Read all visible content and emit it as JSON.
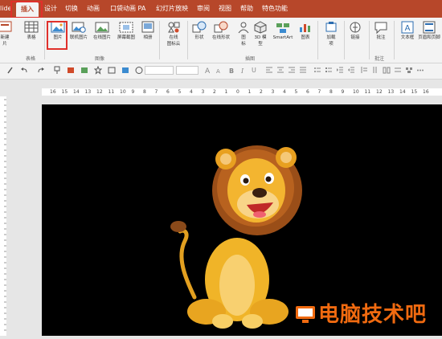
{
  "tabs": [
    {
      "label": "lide",
      "active": false
    },
    {
      "label": "插入",
      "active": true
    },
    {
      "label": "设计",
      "active": false
    },
    {
      "label": "切换",
      "active": false
    },
    {
      "label": "动画",
      "active": false
    },
    {
      "label": "口袋动画 PA",
      "active": false
    },
    {
      "label": "幻灯片放映",
      "active": false
    },
    {
      "label": "审阅",
      "active": false
    },
    {
      "label": "视图",
      "active": false
    },
    {
      "label": "帮助",
      "active": false
    },
    {
      "label": "特色功能",
      "active": false
    }
  ],
  "ribbon": {
    "buttons": [
      {
        "label": "新建",
        "label2": "片",
        "icon": "new-slide-icon"
      },
      {
        "label": "表格",
        "icon": "table-icon"
      },
      {
        "label": "图片",
        "icon": "picture-icon"
      },
      {
        "label": "联机图片",
        "icon": "online-picture-icon"
      },
      {
        "label": "在线图片",
        "icon": "online-image-icon"
      },
      {
        "label": "屏幕截图",
        "icon": "screenshot-icon"
      },
      {
        "label": "相册",
        "icon": "album-icon"
      },
      {
        "label": "在线",
        "label2": "图标云",
        "icon": "icon-cloud-icon"
      },
      {
        "label": "形状",
        "icon": "shapes-icon"
      },
      {
        "label": "在线形状",
        "icon": "online-shapes-icon"
      },
      {
        "label": "图",
        "label2": "标",
        "icon": "icons-icon"
      },
      {
        "label": "3D 模",
        "label2": "型",
        "icon": "3d-model-icon"
      },
      {
        "label": "SmartArt",
        "icon": "smartart-icon"
      },
      {
        "label": "图表",
        "icon": "chart-icon"
      },
      {
        "label": "加载",
        "label2": "项",
        "icon": "addins-icon"
      },
      {
        "label": "链接",
        "icon": "link-icon"
      },
      {
        "label": "批注",
        "icon": "comment-icon"
      },
      {
        "label": "文本框",
        "icon": "textbox-icon"
      },
      {
        "label": "页眉和页脚",
        "icon": "header-footer-icon"
      }
    ],
    "groups": {
      "tables": "表格",
      "images": "图像",
      "illustrations": "插图",
      "comments": "批注"
    }
  },
  "toolbar": {
    "font_name": "",
    "font_size": ""
  },
  "ruler": {
    "ticks": [
      "16",
      "15",
      "14",
      "13",
      "12",
      "11",
      "10",
      "9",
      "8",
      "7",
      "6",
      "5",
      "4",
      "3",
      "2",
      "1",
      "0",
      "1",
      "2",
      "3",
      "4",
      "5",
      "6",
      "7",
      "8",
      "9",
      "10",
      "11",
      "12",
      "13",
      "14",
      "15",
      "16"
    ]
  },
  "watermark": {
    "text": "电脑技术吧"
  },
  "colors": {
    "accent": "#b7472a",
    "highlight_box": "#e0302b",
    "slide_bg": "#000000",
    "watermark": "#f06a10"
  }
}
